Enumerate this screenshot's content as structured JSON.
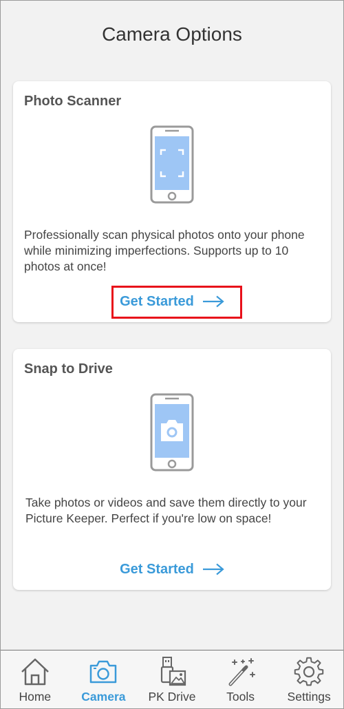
{
  "page_title": "Camera Options",
  "cards": [
    {
      "title": "Photo Scanner",
      "illustration": "phone-scan-frame-icon",
      "description": "Professionally scan physical photos onto your phone while minimizing imperfections. Supports up to 10 photos at once!",
      "cta_label": "Get Started",
      "highlighted": true
    },
    {
      "title": "Snap to Drive",
      "illustration": "phone-camera-icon",
      "description": "Take photos or videos and save them directly to your Picture Keeper. Perfect if you're low on space!",
      "cta_label": "Get Started",
      "highlighted": false
    }
  ],
  "bottom_nav": {
    "active": "Camera",
    "items": [
      {
        "label": "Home",
        "icon": "home-icon"
      },
      {
        "label": "Camera",
        "icon": "camera-icon"
      },
      {
        "label": "PK Drive",
        "icon": "pk-drive-icon"
      },
      {
        "label": "Tools",
        "icon": "magic-wand-icon"
      },
      {
        "label": "Settings",
        "icon": "gear-icon"
      }
    ]
  },
  "colors": {
    "accent": "#3a9ad9",
    "highlight_box": "#e8101a",
    "screen_blue": "#9ec6f5",
    "background": "#f2f2f2"
  }
}
